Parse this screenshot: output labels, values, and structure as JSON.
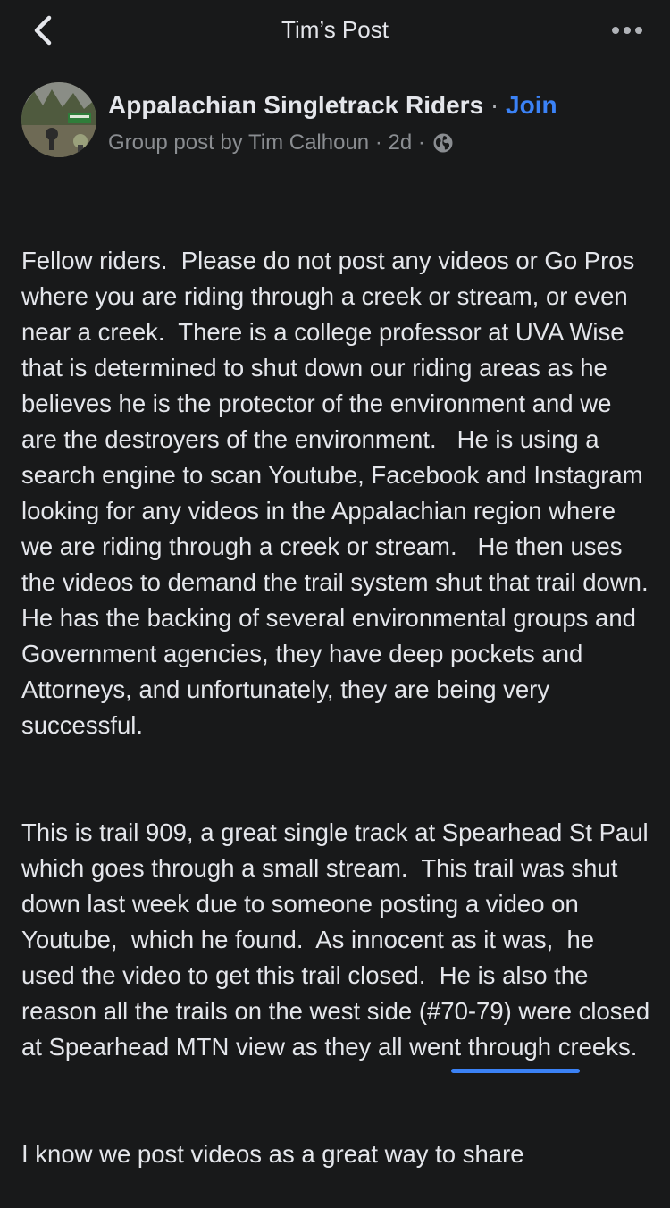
{
  "topbar": {
    "title": "Tim’s Post",
    "back_icon": "chevron-left-icon",
    "more_icon": "more-horizontal-icon"
  },
  "post": {
    "group_name": "Appalachian Singletrack Riders",
    "separator": " · ",
    "join_label": "Join",
    "meta_text": "Group post by Tim Calhoun · 2d ·",
    "privacy_icon": "globe-icon",
    "paragraphs": [
      "Fellow riders.  Please do not post any videos or Go Pros where you are riding through a creek or stream, or even near a creek.  There is a college professor at UVA Wise that is determined to shut down our riding areas as he believes he is the protector of the environment and we are the destroyers of the environment.   He is using a search engine to scan Youtube, Facebook and Instagram looking for any videos in the Appalachian region where we are riding through a creek or stream.   He then uses the videos to demand the trail system shut that trail down.  He has the backing of several environmental groups and Government agencies, they have deep pockets and Attorneys, and unfortunately, they are being very successful.",
      "This is trail 909, a great single track at Spearhead St Paul which goes through a small stream.  This trail was shut down last week due to someone posting a video on Youtube,  which he found.  As innocent as it was,  he used the video to get this trail closed.  He is also the reason all the trails on the west side (#70-79) were closed at Spearhead MTN view as they all went through creeks.",
      "I know we post videos as a great way to share"
    ]
  },
  "colors": {
    "background": "#18191a",
    "text": "#e4e6eb",
    "muted": "#8a8d91",
    "accent": "#3b82f6"
  }
}
